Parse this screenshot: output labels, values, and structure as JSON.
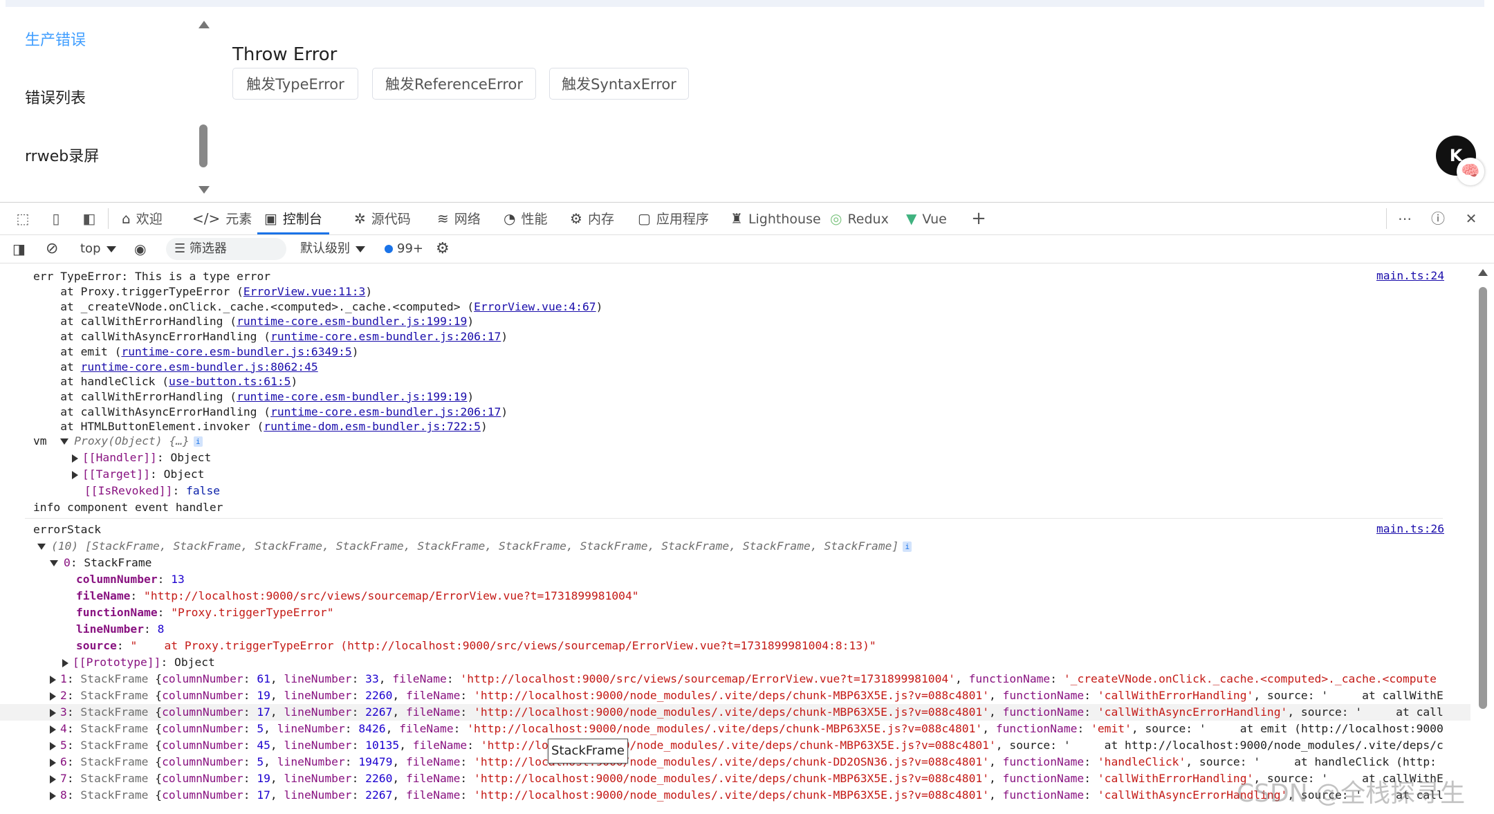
{
  "app": {
    "menu": [
      "生产错误",
      "错误列表",
      "rrweb录屏"
    ],
    "title": "Throw Error",
    "buttons": [
      "触发TypeError",
      "触发ReferenceError",
      "触发SyntaxError"
    ],
    "avatar": "K"
  },
  "devtools": {
    "tabs": [
      {
        "label": "欢迎",
        "icon": "home-icon"
      },
      {
        "label": "元素",
        "icon": "code-icon"
      },
      {
        "label": "控制台",
        "icon": "console-icon"
      },
      {
        "label": "源代码",
        "icon": "bug-icon"
      },
      {
        "label": "网络",
        "icon": "wifi-icon"
      },
      {
        "label": "性能",
        "icon": "performance-icon"
      },
      {
        "label": "内存",
        "icon": "memory-icon"
      },
      {
        "label": "应用程序",
        "icon": "application-icon"
      },
      {
        "label": "Lighthouse",
        "icon": "lighthouse-icon"
      },
      {
        "label": "Redux",
        "icon": "redux-icon"
      },
      {
        "label": "Vue",
        "icon": "vue-icon"
      }
    ],
    "toolbar": {
      "context": "top",
      "filter_placeholder": "筛选器",
      "levels": "默认级别",
      "issues": "99+"
    },
    "console": {
      "msg1": {
        "source": "main.ts:24",
        "head": "err TypeError: This is a type error",
        "frames": [
          {
            "pre": "    at Proxy.triggerTypeError (",
            "link": "ErrorView.vue:11:3",
            "post": ")"
          },
          {
            "pre": "    at _createVNode.onClick._cache.<computed>._cache.<computed> (",
            "link": "ErrorView.vue:4:67",
            "post": ")"
          },
          {
            "pre": "    at callWithErrorHandling (",
            "link": "runtime-core.esm-bundler.js:199:19",
            "post": ")"
          },
          {
            "pre": "    at callWithAsyncErrorHandling (",
            "link": "runtime-core.esm-bundler.js:206:17",
            "post": ")"
          },
          {
            "pre": "    at emit (",
            "link": "runtime-core.esm-bundler.js:6349:5",
            "post": ")"
          },
          {
            "pre": "    at ",
            "link": "runtime-core.esm-bundler.js:8062:45",
            "post": ""
          },
          {
            "pre": "    at handleClick (",
            "link": "use-button.ts:61:5",
            "post": ")"
          },
          {
            "pre": "    at callWithErrorHandling (",
            "link": "runtime-core.esm-bundler.js:199:19",
            "post": ")"
          },
          {
            "pre": "    at callWithAsyncErrorHandling (",
            "link": "runtime-core.esm-bundler.js:206:17",
            "post": ")"
          },
          {
            "pre": "    at HTMLButtonElement.invoker (",
            "link": "runtime-dom.esm-bundler.js:722:5",
            "post": ")"
          }
        ],
        "vm_label": "vm",
        "vm_proxy": "Proxy(Object) {…}",
        "handler": "[[Handler]]",
        "target": "[[Target]]",
        "object": "Object",
        "isrevoked": "[[IsRevoked]]",
        "false": "false",
        "info": "info component event handler"
      },
      "msg2": {
        "source": "main.ts:26",
        "label": "errorStack",
        "array_summary": "(10) [StackFrame, StackFrame, StackFrame, StackFrame, StackFrame, StackFrame, StackFrame, StackFrame, StackFrame, StackFrame]",
        "frame0_label": "0",
        "frame0_type": "StackFrame",
        "props": [
          {
            "key": "columnNumber",
            "value": "13",
            "kind": "num"
          },
          {
            "key": "fileName",
            "value": "\"http://localhost:9000/src/views/sourcemap/ErrorView.vue?t=1731899981004\"",
            "kind": "str"
          },
          {
            "key": "functionName",
            "value": "\"Proxy.triggerTypeError\"",
            "kind": "str"
          },
          {
            "key": "lineNumber",
            "value": "8",
            "kind": "num"
          },
          {
            "key": "source",
            "value": "\"    at Proxy.triggerTypeError (http://localhost:9000/src/views/sourcemap/ErrorView.vue?t=1731899981004:8:13)\"",
            "kind": "str"
          }
        ],
        "prototype": "[[Prototype]]",
        "prototype_val": "Object",
        "rows": [
          {
            "idx": "1",
            "col": "61",
            "line": "33",
            "file": "'http://localhost:9000/src/views/sourcemap/ErrorView.vue?t=1731899981004'",
            "fn": "'_createVNode.onClick._cache.<computed>._cache.<compute",
            "tail": ""
          },
          {
            "idx": "2",
            "col": "19",
            "line": "2260",
            "file": "'http://localhost:9000/node_modules/.vite/deps/chunk-MBP63X5E.js?v=088c4801'",
            "fn": "'callWithErrorHandling'",
            "tail": ", source: '     at callWithE"
          },
          {
            "idx": "3",
            "col": "17",
            "line": "2267",
            "file": "'http://localhost:9000/node_modules/.vite/deps/chunk-MBP63X5E.js?v=088c4801'",
            "fn": "'callWithAsyncErrorHandling'",
            "tail": ", source: '     at call"
          },
          {
            "idx": "4",
            "col": "5",
            "line": "8426",
            "file": "'http://localhost:9000/node_modules/.vite/deps/chunk-MBP63X5E.js?v=088c4801'",
            "fn": "'emit'",
            "tail": ", source: '     at emit (http://localhost:9000"
          },
          {
            "idx": "5",
            "col": "45",
            "line": "10135",
            "file": "'http://localhost:9000/node_modules/.vite/deps/chunk-MBP63X5E.js?v=088c4801'",
            "fn": "",
            "tail": "source: '     at http://localhost:9000/node_modules/.vite/deps/c"
          },
          {
            "idx": "6",
            "col": "5",
            "line": "19479",
            "file": "'http://localhost:9000/node_modules/.vite/deps/chunk-DD2OSN36.js?v=088c4801'",
            "fn": "'handleClick'",
            "tail": ", source: '     at handleClick (http:"
          },
          {
            "idx": "7",
            "col": "19",
            "line": "2260",
            "file": "'http://localhost:9000/node_modules/.vite/deps/chunk-MBP63X5E.js?v=088c4801'",
            "fn": "'callWithErrorHandling'",
            "tail": ", source: '     at callWithE"
          },
          {
            "idx": "8",
            "col": "17",
            "line": "2267",
            "file": "'http://localhost:9000/node_modules/.vite/deps/chunk-MBP63X5E.js?v=088c4801'",
            "fn": "'callWithAsyncErrorHandling'",
            "tail": ", source: '     at call"
          }
        ],
        "sf": "StackFrame"
      },
      "tooltip": "StackFrame",
      "watermark": "CSDN @全栈探寻生"
    }
  }
}
